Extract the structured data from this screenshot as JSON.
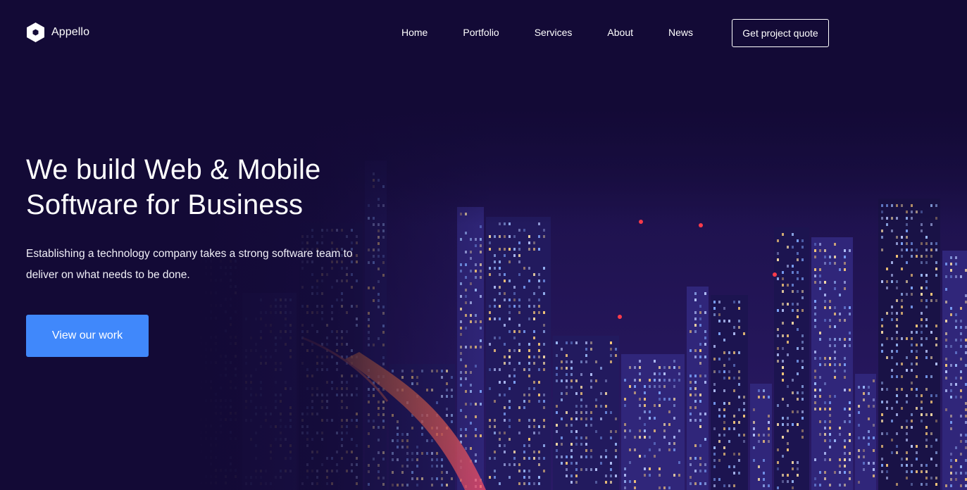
{
  "brand": {
    "name": "Appello",
    "icon": "hexagon-logo-icon"
  },
  "nav": {
    "items": [
      {
        "label": "Home"
      },
      {
        "label": "Portfolio"
      },
      {
        "label": "Services"
      },
      {
        "label": "About"
      },
      {
        "label": "News"
      }
    ],
    "cta_label": "Get project quote"
  },
  "hero": {
    "title_line1": "We build Web & Mobile",
    "title_line2": "Software for Business",
    "desc_line1": "Establishing a technology company takes a strong software team to",
    "desc_line2": "deliver on what needs to be done.",
    "cta_label": "View our work"
  },
  "colors": {
    "background": "#130a36",
    "accent": "#4088fb",
    "text": "#ffffff"
  }
}
